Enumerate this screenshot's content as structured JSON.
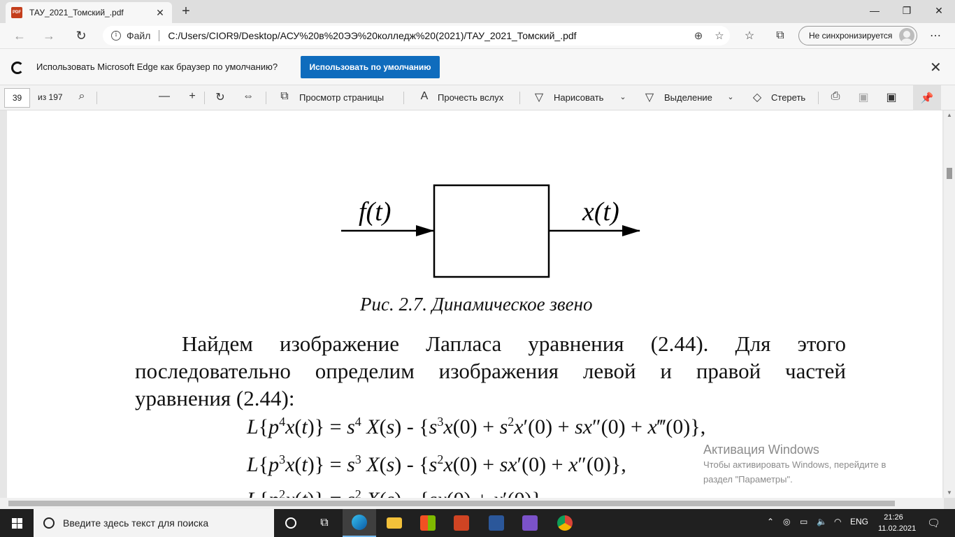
{
  "tab": {
    "title": "ТАУ_2021_Томский_.pdf",
    "icon": "pdf-icon",
    "icon_text": "PDF"
  },
  "address": {
    "scheme": "Файл",
    "url": "C:/Users/CIOR9/Desktop/АСУ%20в%20ЭЭ%20колледж%20(2021)/ТАУ_2021_Томский_.pdf",
    "sync_label": "Не синхронизируется"
  },
  "infobar": {
    "message": "Использовать Microsoft Edge как браузер по умолчанию?",
    "button": "Использовать по умолчанию"
  },
  "pdf_toolbar": {
    "page_number": "39",
    "page_total": "из 197",
    "page_view": "Просмотр страницы",
    "read_aloud": "Прочесть вслух",
    "draw": "Нарисовать",
    "highlight": "Выделение",
    "erase": "Стереть"
  },
  "document": {
    "diagram": {
      "input": "f(t)",
      "output": "x(t)"
    },
    "caption": "Рис. 2.7. Динамическое звено",
    "paragraph_lines": [
      "Найдем изображение Лапласа уравнения (2.44). Для этого",
      "последовательно определим изображения левой и правой частей",
      "уравнения (2.44):"
    ]
  },
  "watermark": {
    "title": "Активация Windows",
    "line1": "Чтобы активировать Windows, перейдите в",
    "line2": "раздел \"Параметры\"."
  },
  "taskbar": {
    "search_placeholder": "Введите здесь текст для поиска",
    "language": "ENG",
    "time": "21:26",
    "date": "11.02.2021"
  }
}
